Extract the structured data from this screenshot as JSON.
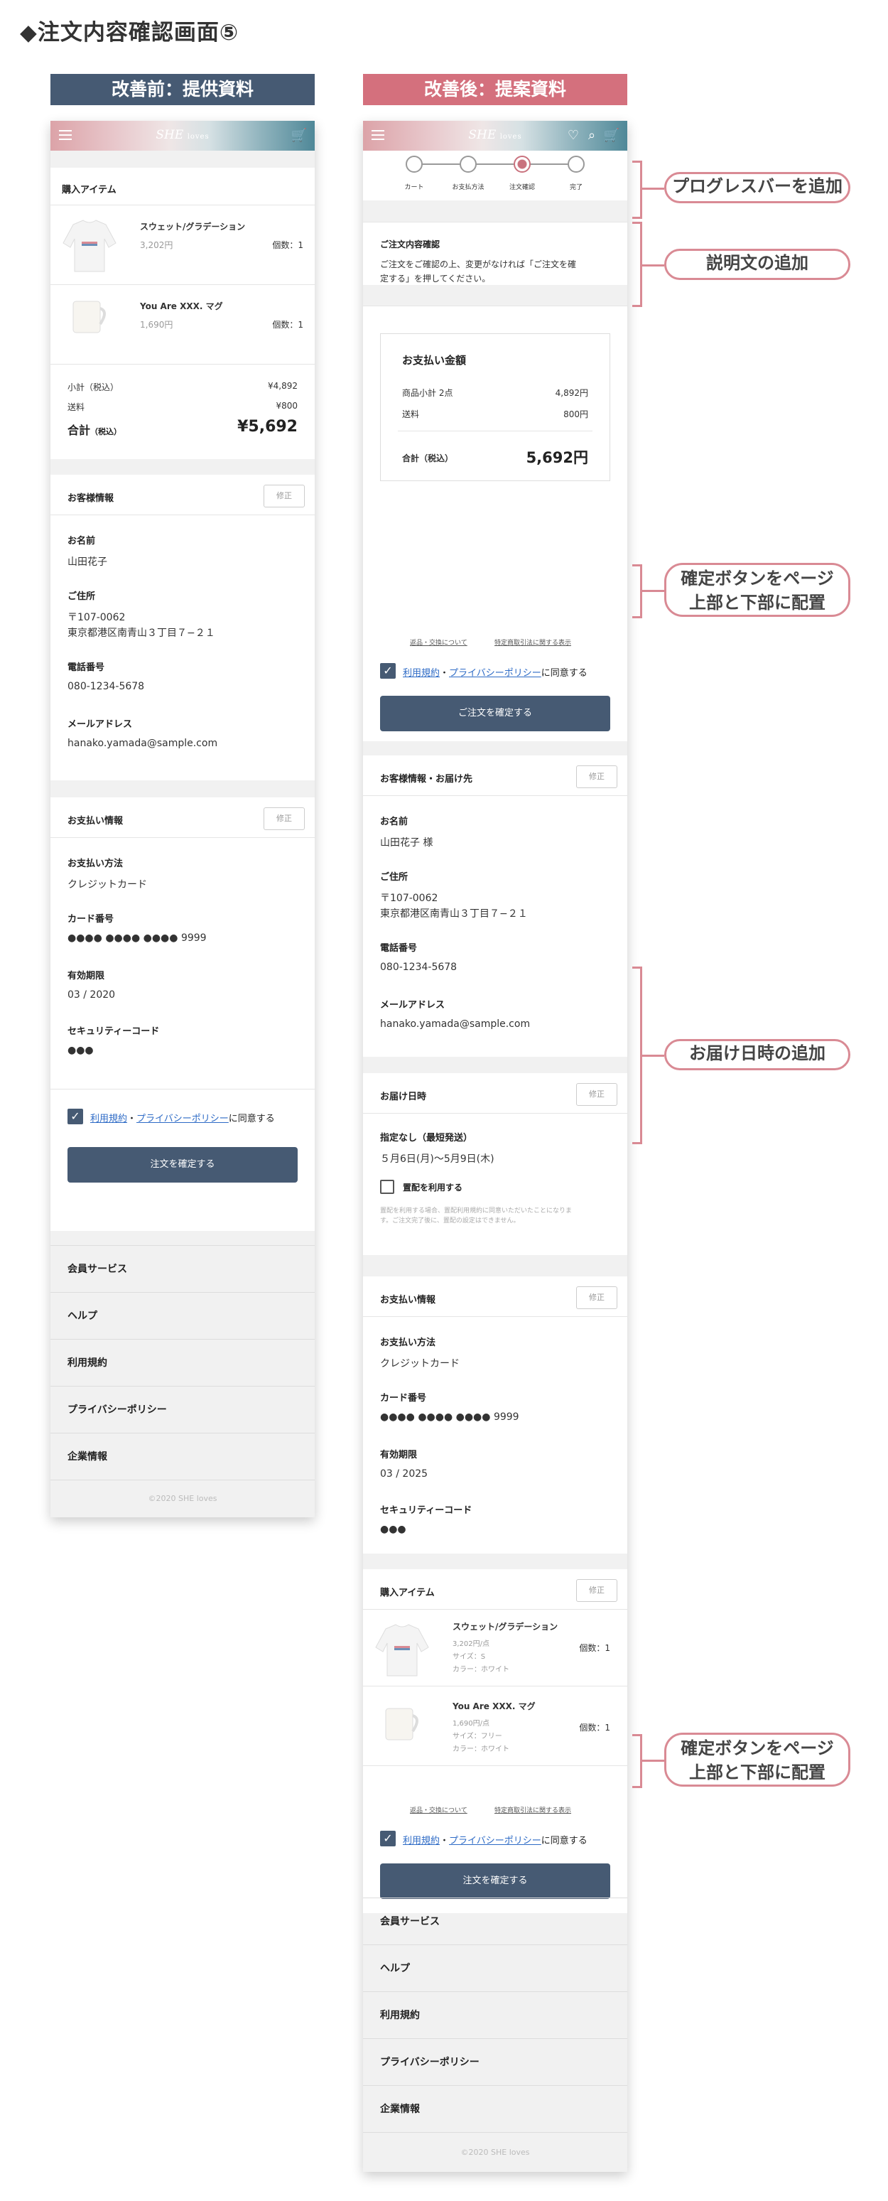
{
  "page_title": "◆注文内容確認画面⑤",
  "before": {
    "banner": "改善前：提供資料",
    "header": {
      "logo": "SHE",
      "logo_sub": "loves"
    },
    "items_section": {
      "title": "購入アイテム",
      "items": [
        {
          "name": "スウェット/グラデーション",
          "price": "3,202円",
          "qty": "個数：1"
        },
        {
          "name": "You Are XXX. マグ",
          "price": "1,690円",
          "qty": "個数：1"
        }
      ]
    },
    "totals": {
      "subtotal_label": "小計（税込）",
      "subtotal": "¥4,892",
      "shipping_label": "送料",
      "shipping": "¥800",
      "total_label": "合計",
      "total_tax": "（税込）",
      "total": "¥5,692"
    },
    "customer": {
      "title": "お客様情報",
      "edit": "修正",
      "name_label": "お名前",
      "name": "山田花子",
      "address_label": "ご住所",
      "zip": "〒107-0062",
      "address": "東京都港区南青山３丁目７−２１",
      "phone_label": "電話番号",
      "phone": "080-1234-5678",
      "email_label": "メールアドレス",
      "email": "hanako.yamada@sample.com"
    },
    "payment": {
      "title": "お支払い情報",
      "edit": "修正",
      "method_label": "お支払い方法",
      "method": "クレジットカード",
      "card_label": "カード番号",
      "card": "●●●● ●●●● ●●●●",
      "card_last": "9999",
      "exp_label": "有効期限",
      "exp": "03 / 2020",
      "cvc_label": "セキュリティーコード",
      "cvc": "●●●"
    },
    "agree": {
      "terms": "利用規約",
      "dot": "・",
      "privacy": "プライバシーポリシー",
      "suffix": "に同意する"
    },
    "confirm": "注文を確定する",
    "footer": [
      "会員サービス",
      "ヘルプ",
      "利用規約",
      "プライバシーポリシー",
      "企業情報"
    ],
    "copyright": "©2020 SHE loves"
  },
  "after": {
    "banner": "改善後：提案資料",
    "header": {
      "logo": "SHE",
      "logo_sub": "loves"
    },
    "progress": [
      "カート",
      "お支払方法",
      "注文確認",
      "完了"
    ],
    "intro": {
      "title": "ご注文内容確認",
      "text1": "ご注文をご確認の上、変更がなければ「ご注文を確",
      "text2": "定する」を押してください。"
    },
    "summary": {
      "title": "お支払い金額",
      "subtotal_label": "商品小計 2点",
      "subtotal": "4,892円",
      "shipping_label": "送料",
      "shipping": "800円",
      "total_label": "合計（税込）",
      "total": "5,692円"
    },
    "links": {
      "returns": "返品・交換について",
      "law": "特定商取引法に関する表示"
    },
    "agree": {
      "terms": "利用規約",
      "dot": "・",
      "privacy": "プライバシーポリシー",
      "suffix": "に同意する"
    },
    "confirm": "ご注文を確定する",
    "customer": {
      "title": "お客様情報・お届け先",
      "edit": "修正",
      "name_label": "お名前",
      "name": "山田花子 様",
      "address_label": "ご住所",
      "zip": "〒107-0062",
      "address": "東京都港区南青山３丁目７−２１",
      "phone_label": "電話番号",
      "phone": "080-1234-5678",
      "email_label": "メールアドレス",
      "email": "hanako.yamada@sample.com"
    },
    "delivery": {
      "title": "お届け日時",
      "edit": "修正",
      "option": "指定なし（最短発送）",
      "range": "５月6日(月)〜5月9日(木)",
      "place_label": "置配を利用する",
      "place_note1": "置配を利用する場合、置配利用規約に同意いただいたことになりま",
      "place_note2": "す。ご注文完了後に、置配の設定はできません。"
    },
    "payment": {
      "title": "お支払い情報",
      "edit": "修正",
      "method_label": "お支払い方法",
      "method": "クレジットカード",
      "card_label": "カード番号",
      "card": "●●●● ●●●● ●●●●",
      "card_last": "9999",
      "exp_label": "有効期限",
      "exp": "03 / 2025",
      "cvc_label": "セキュリティーコード",
      "cvc": "●●●"
    },
    "items_section": {
      "title": "購入アイテム",
      "edit": "修正",
      "items": [
        {
          "name": "スウェット/グラデーション",
          "price": "3,202円/点",
          "size": "サイズ：S",
          "color": "カラー：ホワイト",
          "qty": "個数：1"
        },
        {
          "name": "You Are XXX. マグ",
          "price": "1,690円/点",
          "size": "サイズ：フリー",
          "color": "カラー：ホワイト",
          "qty": "個数：1"
        }
      ]
    },
    "confirm_bottom": "注文を確定する",
    "footer": [
      "会員サービス",
      "ヘルプ",
      "利用規約",
      "プライバシーポリシー",
      "企業情報"
    ],
    "copyright": "©2020 SHE loves"
  },
  "annotations": {
    "progress": "プログレスバーを追加",
    "description": "説明文の追加",
    "confirm_top_1": "確定ボタンをページ",
    "confirm_top_2": "上部と下部に配置",
    "delivery": "お届け日時の追加",
    "confirm_bottom_1": "確定ボタンをページ",
    "confirm_bottom_2": "上部と下部に配置"
  }
}
